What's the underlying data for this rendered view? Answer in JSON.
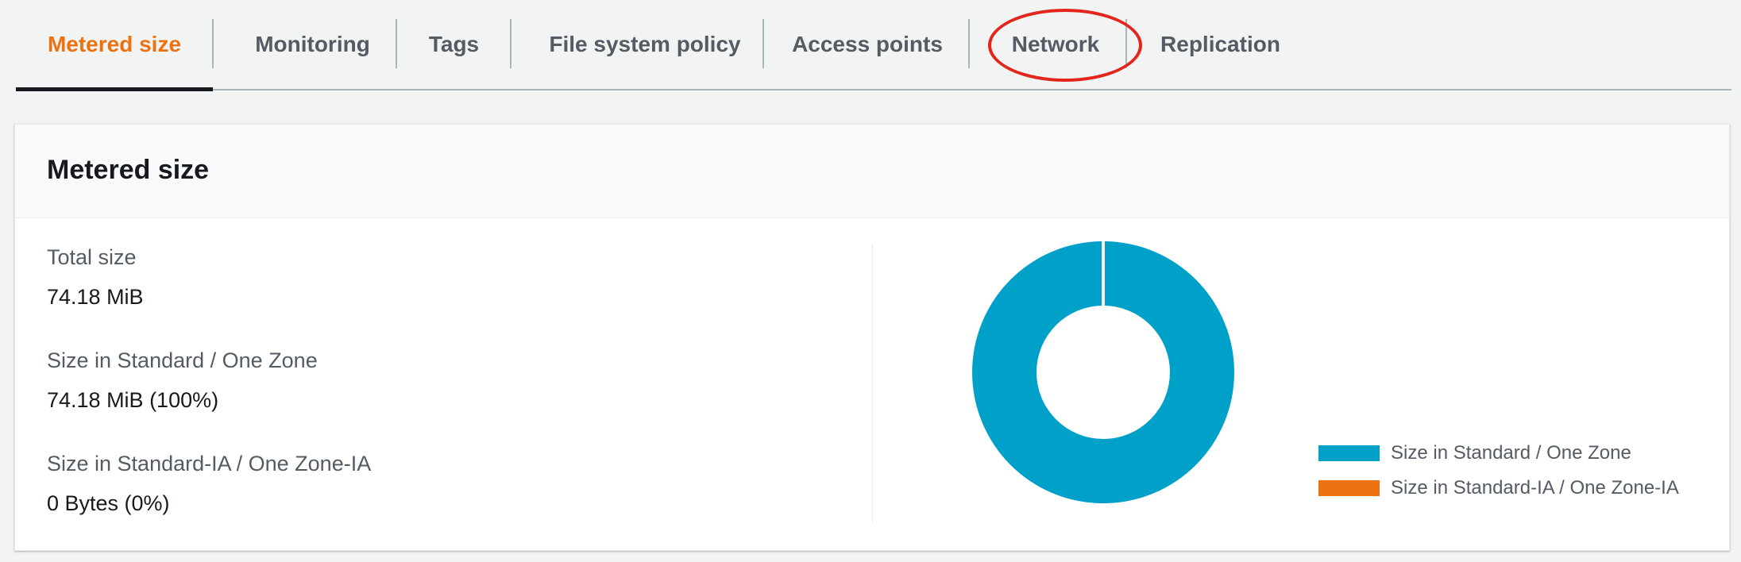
{
  "tabs": [
    {
      "label": "Metered size",
      "active": true
    },
    {
      "label": "Monitoring",
      "active": false
    },
    {
      "label": "Tags",
      "active": false
    },
    {
      "label": "File system policy",
      "active": false
    },
    {
      "label": "Access points",
      "active": false
    },
    {
      "label": "Network",
      "active": false,
      "highlighted": true
    },
    {
      "label": "Replication",
      "active": false
    }
  ],
  "colors": {
    "active_tab": "#ec7211",
    "annotation": "#e3251b",
    "standard": "#00a1c9",
    "standard_ia": "#ec7211"
  },
  "panel": {
    "title": "Metered size",
    "details": [
      {
        "key": "Total size",
        "value": "74.18 MiB"
      },
      {
        "key": "Size in Standard / One Zone",
        "value": "74.18 MiB (100%)"
      },
      {
        "key": "Size in Standard-IA / One Zone-IA",
        "value": "0 Bytes (0%)"
      }
    ]
  },
  "chart_data": {
    "type": "pie",
    "variant": "donut",
    "series": [
      {
        "name": "Size in Standard / One Zone",
        "value": 100,
        "color": "#00a1c9"
      },
      {
        "name": "Size in Standard-IA / One Zone-IA",
        "value": 0,
        "color": "#ec7211"
      }
    ],
    "legend_placement": "bottom-right"
  }
}
